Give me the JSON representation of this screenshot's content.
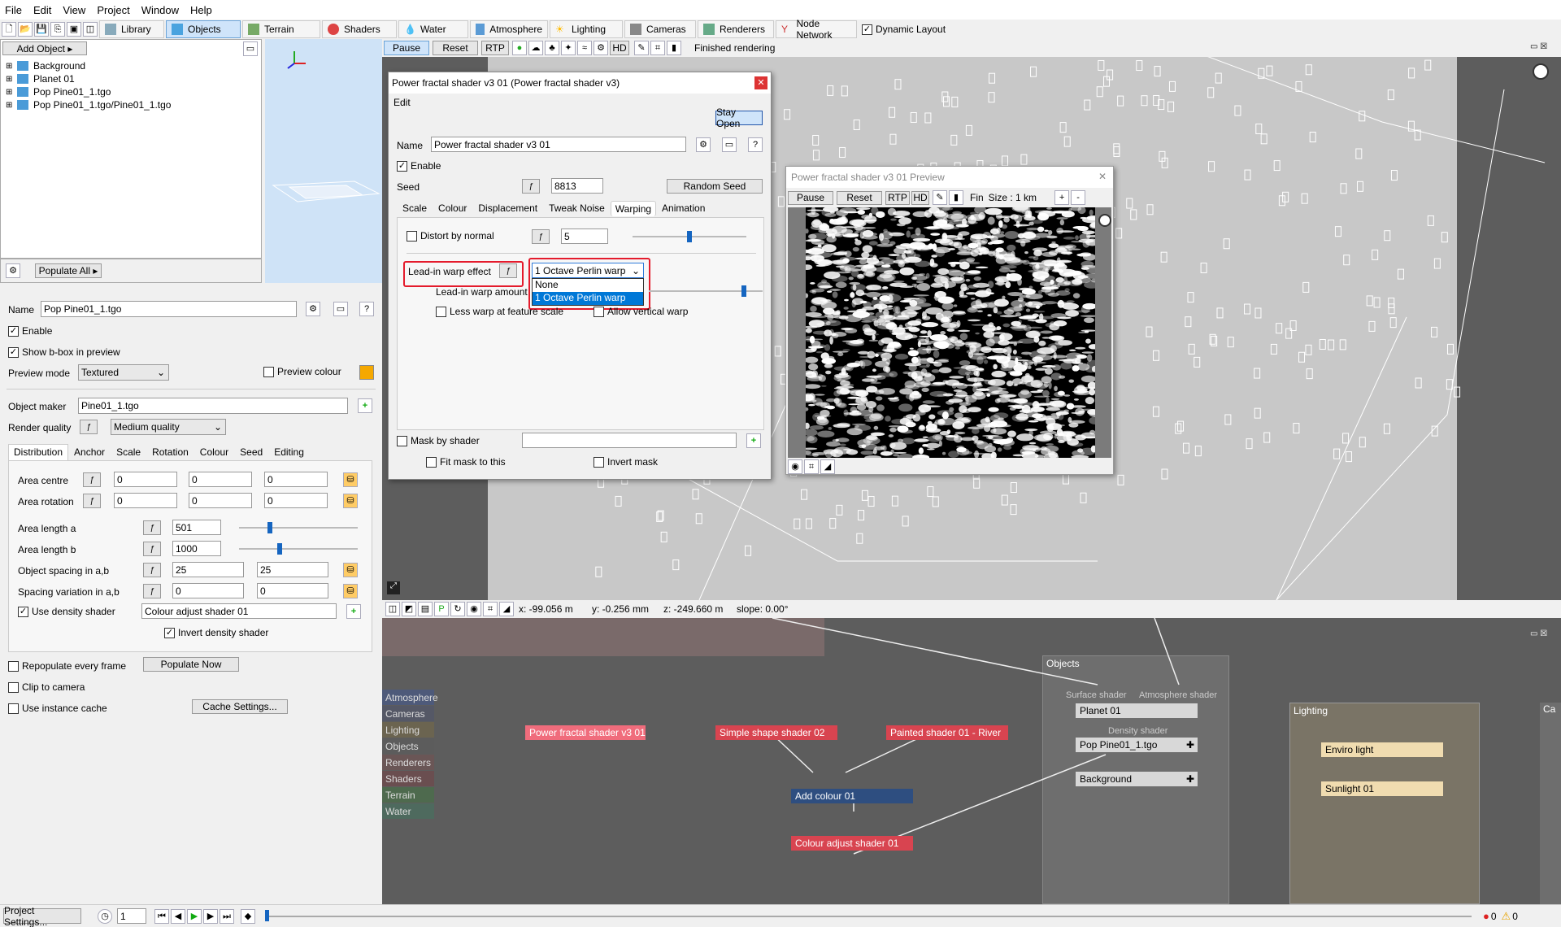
{
  "menu": [
    "File",
    "Edit",
    "View",
    "Project",
    "Window",
    "Help"
  ],
  "toolbar": {
    "tabs": [
      "Library",
      "Objects",
      "Terrain",
      "Shaders",
      "Water",
      "Atmosphere",
      "Lighting",
      "Cameras",
      "Renderers",
      "Node Network"
    ],
    "dynamic_layout": "Dynamic Layout"
  },
  "scene": {
    "add_object": "Add Object",
    "items": [
      "Background",
      "Planet 01",
      "Pop Pine01_1.tgo",
      "Pop Pine01_1.tgo/Pine01_1.tgo"
    ],
    "populate_all": "Populate All"
  },
  "render_bar": {
    "pause": "Pause",
    "reset": "Reset",
    "rtp": "RTP",
    "hd": "HD",
    "status": "Finished rendering"
  },
  "props": {
    "name_label": "Name",
    "name_value": "Pop Pine01_1.tgo",
    "enable": "Enable",
    "show_bbox": "Show b-box in preview",
    "preview_mode_label": "Preview mode",
    "preview_mode_value": "Textured",
    "preview_colour": "Preview colour",
    "object_maker_label": "Object maker",
    "object_maker_value": "Pine01_1.tgo",
    "render_quality_label": "Render quality",
    "render_quality_value": "Medium quality",
    "tabs": [
      "Distribution",
      "Anchor",
      "Scale",
      "Rotation",
      "Colour",
      "Seed",
      "Editing"
    ],
    "area_centre": "Area centre",
    "area_rotation": "Area rotation",
    "zero": "0",
    "area_length_a": "Area length a",
    "area_length_a_value": "501",
    "area_length_b": "Area length b",
    "area_length_b_value": "1000",
    "object_spacing": "Object spacing in a,b",
    "spacing_value": "25",
    "spacing_variation": "Spacing variation in a,b",
    "use_density": "Use density shader",
    "density_value": "Colour adjust shader 01",
    "invert_density": "Invert density shader",
    "repopulate": "Repopulate every frame",
    "populate_now": "Populate Now",
    "clip_camera": "Clip to camera",
    "instance_cache": "Use instance cache",
    "cache_settings": "Cache Settings..."
  },
  "dialog": {
    "title": "Power fractal shader v3 01   (Power fractal shader v3)",
    "edit": "Edit",
    "stay_open": "Stay Open",
    "name_label": "Name",
    "name_value": "Power fractal shader v3 01",
    "enable": "Enable",
    "seed_label": "Seed",
    "seed_value": "8813",
    "random_seed": "Random Seed",
    "tabs": [
      "Scale",
      "Colour",
      "Displacement",
      "Tweak Noise",
      "Warping",
      "Animation"
    ],
    "distort_normal": "Distort by normal",
    "distort_value": "5",
    "leadin_label": "Lead-in warp effect",
    "leadin_value": "1 Octave Perlin warp",
    "dropdown_options": [
      "None",
      "1 Octave Perlin warp"
    ],
    "leadin_amount": "Lead-in warp amount",
    "less_warp": "Less warp at feature scale",
    "allow_vertical": "Allow vertical warp",
    "mask_by_shader": "Mask by shader",
    "fit_mask": "Fit mask to this",
    "invert_mask": "Invert mask"
  },
  "preview": {
    "title": "Power fractal shader v3 01 Preview",
    "pause": "Pause",
    "reset": "Reset",
    "rtp": "RTP",
    "hd": "HD",
    "fin": "Fin",
    "size": "Size : 1 km"
  },
  "statusbar": {
    "x": "x: -99.056 m",
    "y": "y: -0.256 mm",
    "z": "z: -249.660 m",
    "slope": "slope: 0.00°"
  },
  "nodes": {
    "categories": [
      "Atmosphere",
      "Cameras",
      "Lighting",
      "Objects",
      "Renderers",
      "Shaders",
      "Terrain",
      "Water"
    ],
    "power_fractal": "Power fractal shader v3 01",
    "simple_shape": "Simple shape shader 02",
    "painted": "Painted shader 01 - River",
    "add_colour": "Add colour 01",
    "colour_adjust": "Colour adjust shader 01",
    "objects_group": "Objects",
    "surface_shader": "Surface shader",
    "atmosphere_shader": "Atmosphere shader",
    "planet": "Planet 01",
    "density_shader": "Density shader",
    "pop_pine": "Pop Pine01_1.tgo",
    "background": "Background",
    "lighting_group": "Lighting",
    "enviro": "Enviro light",
    "sunlight": "Sunlight 01",
    "ca": "Ca"
  },
  "bottom": {
    "project_settings": "Project Settings...",
    "frame": "1",
    "errors": "0",
    "warnings": "0"
  }
}
